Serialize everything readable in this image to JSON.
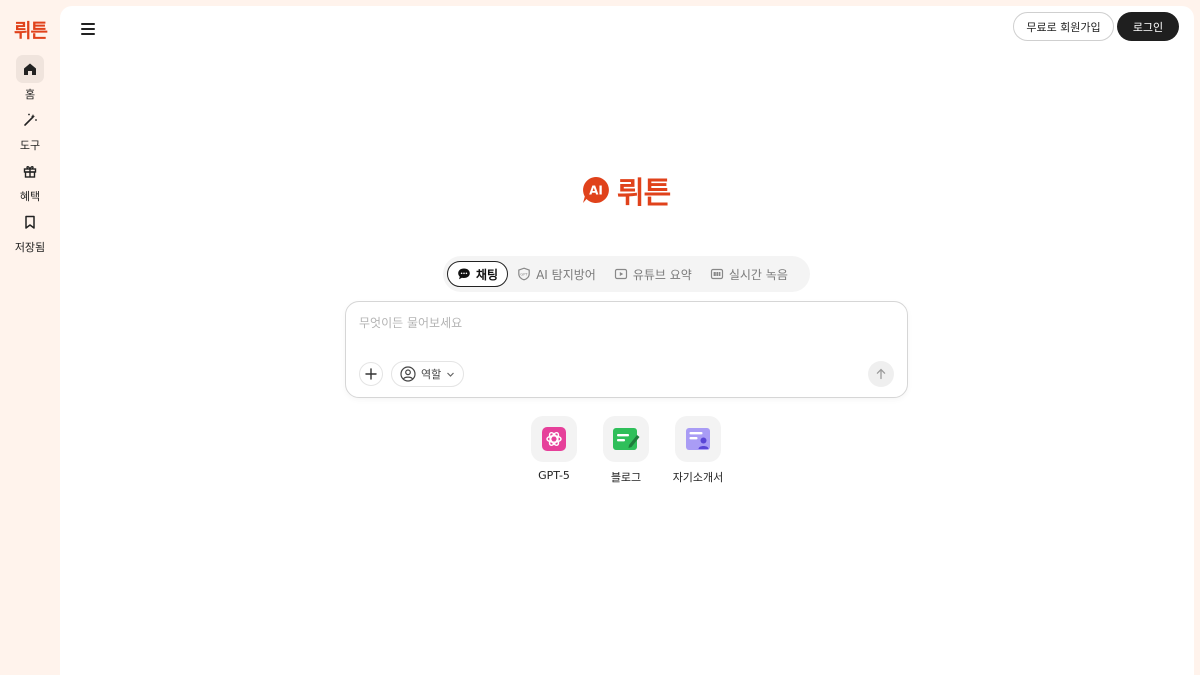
{
  "brand": {
    "name": "뤼튼",
    "logo_badge": "AI",
    "logo_text": "뤼튼",
    "accent_color": "#e0421b"
  },
  "rail": {
    "items": [
      {
        "label": "홈",
        "icon": "home-icon",
        "active": true
      },
      {
        "label": "도구",
        "icon": "magic-wand-icon",
        "active": false
      },
      {
        "label": "혜택",
        "icon": "gift-icon",
        "active": false
      },
      {
        "label": "저장됨",
        "icon": "bookmark-icon",
        "active": false
      }
    ]
  },
  "header": {
    "signup_label": "무료로 회원가입",
    "login_label": "로그인"
  },
  "tabs": [
    {
      "label": "채팅",
      "icon": "chat-bubble-icon",
      "active": true
    },
    {
      "label": "AI 탐지방어",
      "icon": "shield-gpt-icon",
      "active": false
    },
    {
      "label": "유튜브 요약",
      "icon": "play-icon",
      "active": false
    },
    {
      "label": "실시간 녹음",
      "icon": "recording-icon",
      "active": false
    }
  ],
  "chat": {
    "placeholder": "무엇이든 물어보세요",
    "role_label": "역할"
  },
  "shortcuts": [
    {
      "label": "GPT-5",
      "icon": "openai-icon",
      "color": "#e6409a"
    },
    {
      "label": "블로그",
      "icon": "blog-icon",
      "color": "#2fbf5a"
    },
    {
      "label": "자기소개서",
      "icon": "resume-icon",
      "color": "#8c7cf0"
    }
  ]
}
